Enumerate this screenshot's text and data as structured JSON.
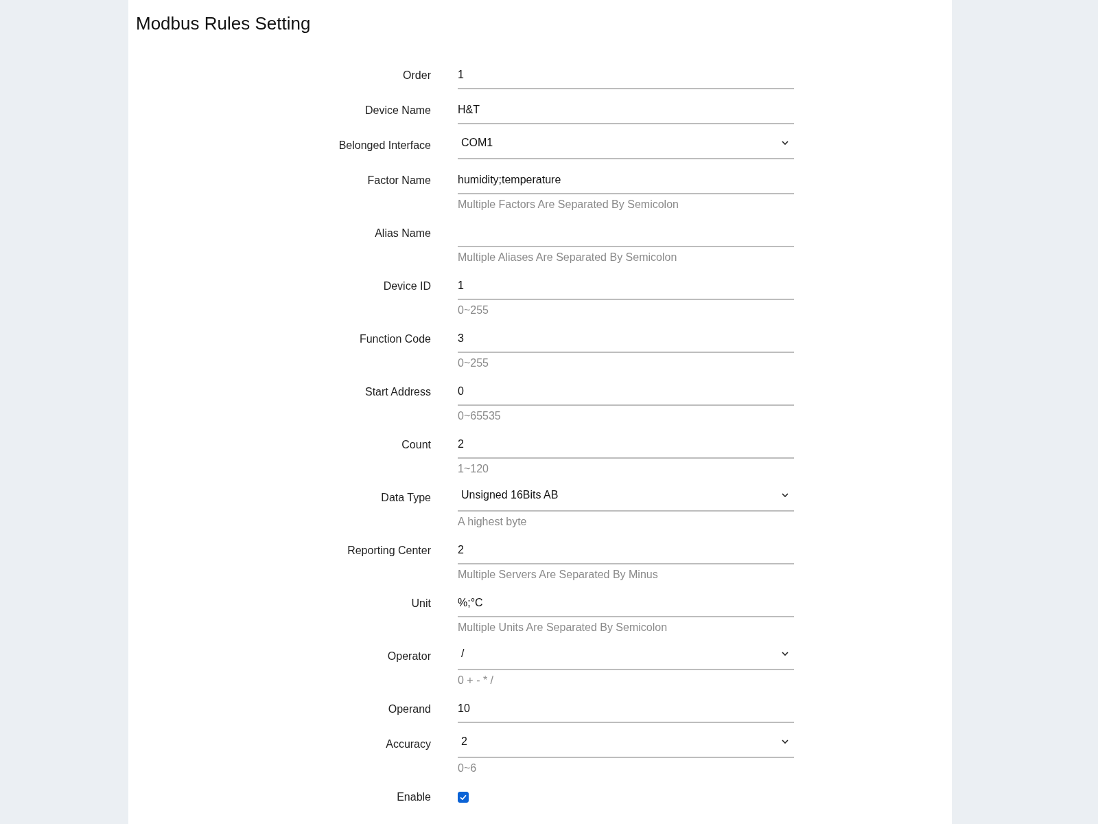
{
  "title": "Modbus Rules Setting",
  "fields": [
    {
      "kind": "text",
      "label": "Order",
      "value": "1"
    },
    {
      "kind": "text",
      "label": "Device Name",
      "value": "H&T"
    },
    {
      "kind": "select",
      "label": "Belonged Interface",
      "value": "COM1"
    },
    {
      "kind": "text",
      "label": "Factor Name",
      "value": "humidity;temperature",
      "hint": "Multiple Factors Are Separated By Semicolon"
    },
    {
      "kind": "text",
      "label": "Alias Name",
      "hint": "Multiple Aliases Are Separated By Semicolon"
    },
    {
      "kind": "text",
      "label": "Device ID",
      "value": "1",
      "hint": "0~255"
    },
    {
      "kind": "text",
      "label": "Function Code",
      "value": "3",
      "hint": "0~255"
    },
    {
      "kind": "text",
      "label": "Start Address",
      "value": "0",
      "hint": "0~65535"
    },
    {
      "kind": "text",
      "label": "Count",
      "value": "2",
      "hint": "1~120"
    },
    {
      "kind": "select",
      "label": "Data Type",
      "value": "Unsigned 16Bits AB",
      "hint": "A highest byte"
    },
    {
      "kind": "text",
      "label": "Reporting Center",
      "value": "2",
      "hint": "Multiple Servers Are Separated By Minus"
    },
    {
      "kind": "text",
      "label": "Unit",
      "value": "%;°C",
      "hint": "Multiple Units Are Separated By Semicolon"
    },
    {
      "kind": "select",
      "label": "Operator",
      "value": "/",
      "hint": "0 + - * /"
    },
    {
      "kind": "text",
      "label": "Operand",
      "value": "10"
    },
    {
      "kind": "select",
      "label": "Accuracy",
      "value": "2",
      "hint": "0~6"
    },
    {
      "kind": "checkbox",
      "label": "Enable",
      "checked": true
    }
  ]
}
